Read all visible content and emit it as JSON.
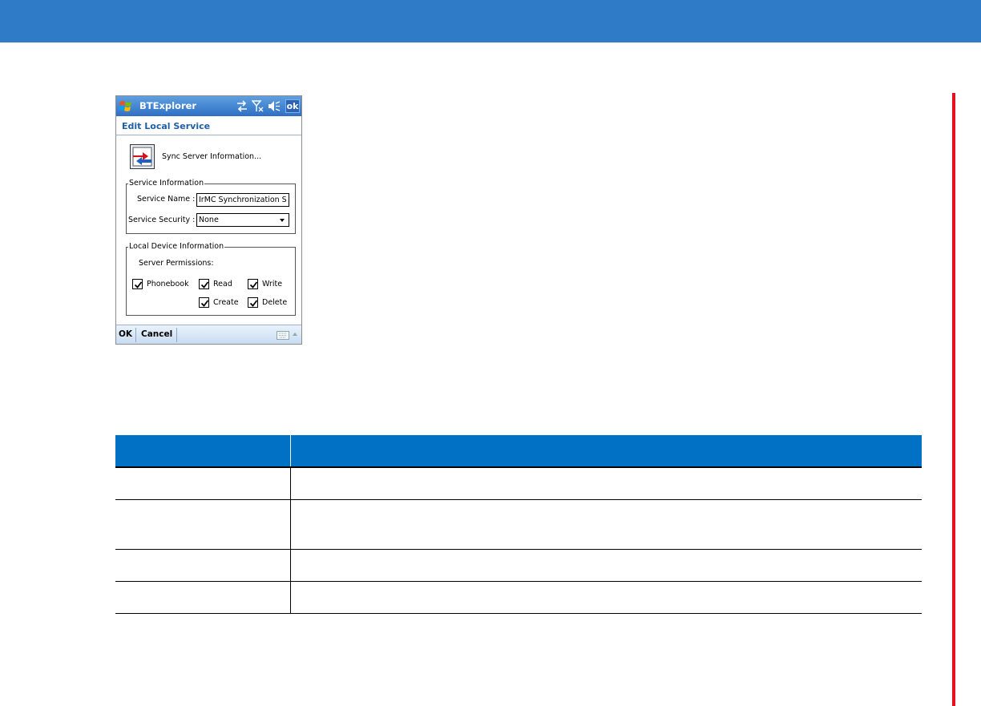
{
  "colors": {
    "banner": "#2f7bc8",
    "side_bar": "#e8101e",
    "table_header": "#0071c5"
  },
  "device": {
    "app_title": "BTExplorer",
    "title_ok": "ok",
    "tray_icons": [
      "sync-arrows-icon",
      "signal-off-icon",
      "speaker-mute-icon"
    ],
    "page_heading": "Edit Local Service",
    "sync_label": "Sync Server Information...",
    "service_info": {
      "legend": "Service Information",
      "name_label": "Service Name :",
      "name_value": "IrMC Synchronization S",
      "security_label": "Service Security :",
      "security_value": "None"
    },
    "local_device": {
      "legend": "Local Device Information",
      "permissions_label": "Server Permissions:",
      "checkboxes": [
        {
          "label": "Phonebook",
          "checked": true
        },
        {
          "label": "Read",
          "checked": true
        },
        {
          "label": "Write",
          "checked": true
        },
        {
          "label": "Create",
          "checked": true
        },
        {
          "label": "Delete",
          "checked": true
        }
      ]
    },
    "menu": {
      "ok": "OK",
      "cancel": "Cancel"
    }
  },
  "table": {
    "headers": [
      "",
      ""
    ],
    "rows": [
      [
        "",
        ""
      ],
      [
        "",
        ""
      ],
      [
        "",
        ""
      ],
      [
        "",
        ""
      ]
    ]
  }
}
